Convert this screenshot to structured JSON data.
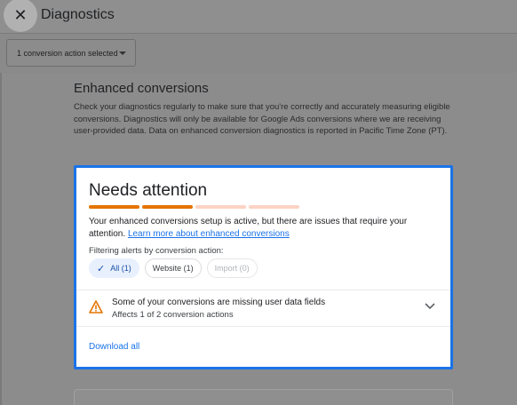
{
  "header": {
    "title": "Diagnostics",
    "close_icon": "close-icon"
  },
  "filter": {
    "dropdown_label": "1 conversion action selected"
  },
  "section": {
    "title": "Enhanced conversions",
    "description": "Check your diagnostics regularly to make sure that you're correctly and accurately measuring eligible conversions. Diagnostics will only be available for Google Ads conversions where we are receiving user-provided data. Data on enhanced conversion diagnostics is reported in Pacific Time Zone (PT)."
  },
  "card": {
    "title": "Needs attention",
    "progress_colors": [
      "#e37400",
      "#e37400",
      "#fbd3c4",
      "#fbd3c4"
    ],
    "message": "Your enhanced conversions setup is active, but there are issues that require your attention.",
    "link_text": "Learn more about enhanced conversions",
    "filter_label": "Filtering alerts by conversion action:",
    "chips": [
      {
        "label": "All (1)",
        "state": "selected"
      },
      {
        "label": "Website (1)",
        "state": "normal"
      },
      {
        "label": "Import (0)",
        "state": "disabled"
      }
    ],
    "alert": {
      "title": "Some of your conversions are missing user data fields",
      "subtitle": "Affects 1 of 2 conversion actions",
      "icon": "warning-icon",
      "color": "#e37400"
    },
    "download_label": "Download all"
  },
  "colors": {
    "accent": "#1a73e8",
    "warning": "#e37400"
  }
}
